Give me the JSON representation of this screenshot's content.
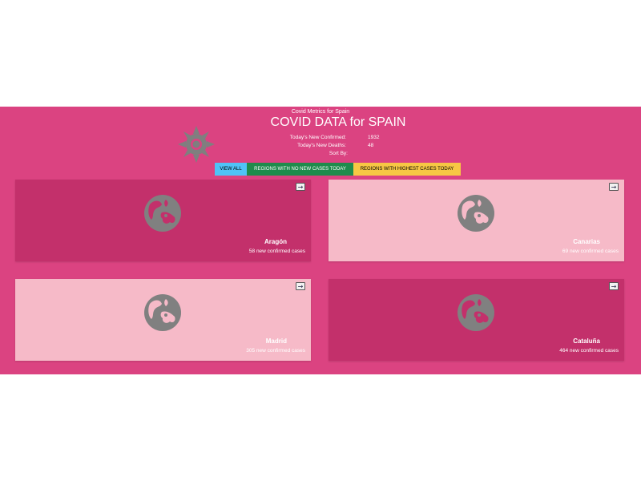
{
  "header": {
    "small_title": "Covid Metrics for Spain",
    "title": "COVID DATA for SPAIN",
    "icon": "sun-icon"
  },
  "stats": {
    "new_confirmed_label": "Today's New Confirmed:",
    "new_confirmed_value": "1932",
    "new_deaths_label": "Today's New Deaths:",
    "new_deaths_value": "48",
    "sort_label": "Sort By:"
  },
  "filters": {
    "view_all": "VIEW ALL",
    "no_new_cases": "REGIONS WITH NO NEW CASES TODAY",
    "highest_cases": "REGIONS WITH HIGHEST CASES TODAY"
  },
  "cards": [
    {
      "name": "Aragón",
      "cases": "58 new confirmed cases",
      "icon": "globe-icon",
      "arrow": "→",
      "theme": "dark"
    },
    {
      "name": "Canarias",
      "cases": "69 new confirmed cases",
      "icon": "globe-icon",
      "arrow": "→",
      "theme": "light"
    },
    {
      "name": "Madrid",
      "cases": "305 new confirmed cases",
      "icon": "globe-icon",
      "arrow": "→",
      "theme": "light"
    },
    {
      "name": "Cataluña",
      "cases": "464 new confirmed cases",
      "icon": "globe-icon",
      "arrow": "→",
      "theme": "dark"
    }
  ],
  "colors": {
    "background": "#db4381",
    "card_dark": "#c3306b",
    "card_light": "#f6bac8",
    "view_all": "#4fc3f7",
    "no_new_cases": "#1f8b4c",
    "highest_cases": "#f7c744",
    "icon_gray": "#808080"
  }
}
